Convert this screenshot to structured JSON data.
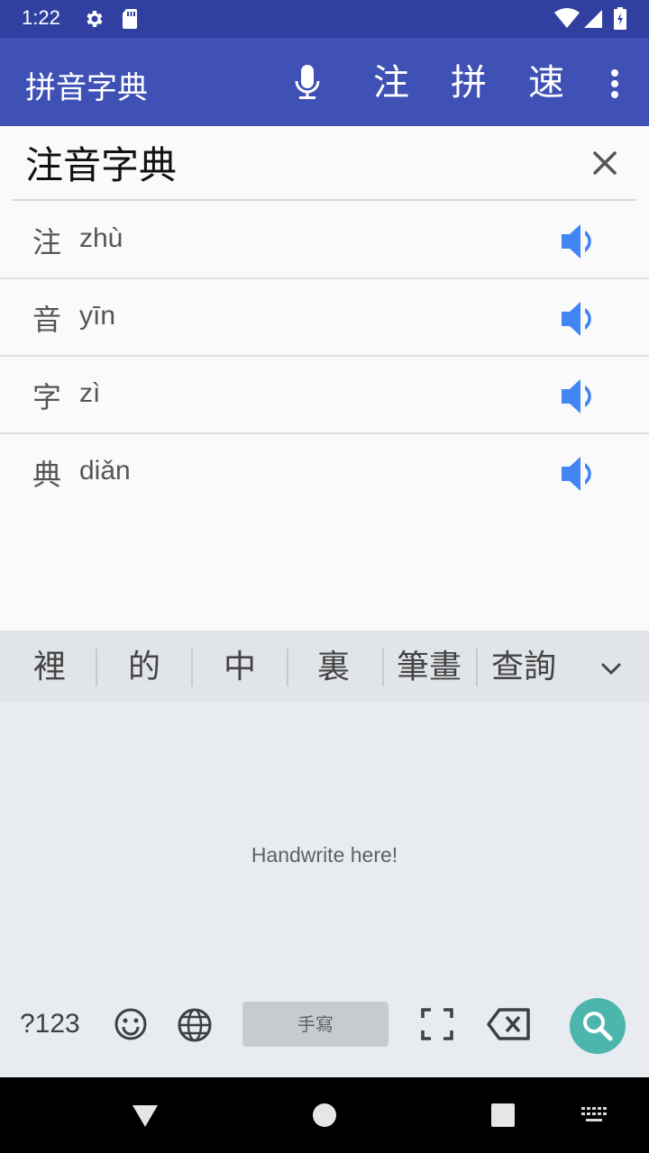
{
  "status_bar": {
    "time": "1:22",
    "icons": [
      "gear-icon",
      "sd-card-icon",
      "wifi-icon",
      "signal-icon",
      "battery-icon"
    ]
  },
  "app_bar": {
    "title": "拼音字典",
    "mic_icon": "mic-icon",
    "actions": [
      "注",
      "拼",
      "速"
    ],
    "menu_icon": "more-vert-icon"
  },
  "search": {
    "value": "注音字典",
    "clear_icon": "close-icon"
  },
  "results": [
    {
      "char": "注",
      "pinyin": "zhù"
    },
    {
      "char": "音",
      "pinyin": "yīn"
    },
    {
      "char": "字",
      "pinyin": "zì"
    },
    {
      "char": "典",
      "pinyin": "diǎn"
    }
  ],
  "keyboard": {
    "candidates": [
      "裡",
      "的",
      "中",
      "裏",
      "筆畫",
      "查詢"
    ],
    "hint": "Handwrite here!",
    "num_key": "?123",
    "space_label": "手寫",
    "icons": [
      "emoji-icon",
      "globe-icon",
      "fullscreen-icon",
      "backspace-icon",
      "search-icon",
      "chevron-down-icon"
    ]
  },
  "colors": {
    "status_bar": "#3140a0",
    "app_bar": "#3f51b5",
    "speaker": "#4285f4",
    "search_fab": "#4db6ac"
  }
}
